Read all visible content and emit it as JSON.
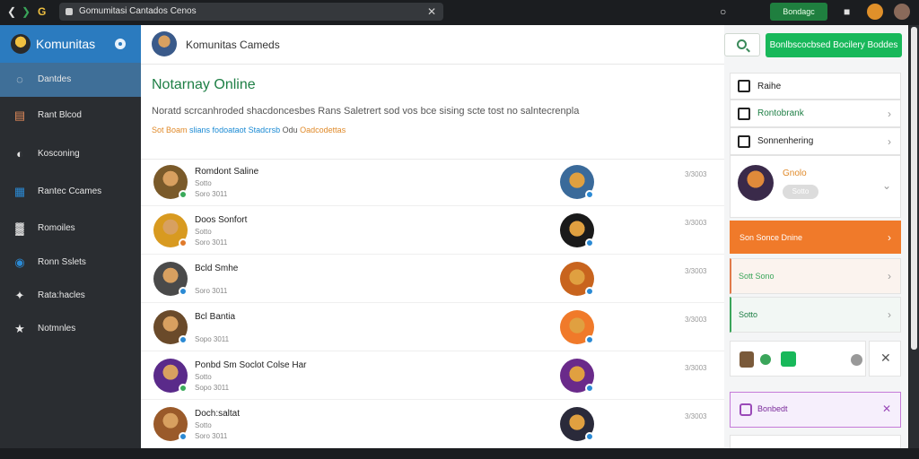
{
  "browser": {
    "tab_title": "Gomumitasi Cantados Cenos",
    "extension_label": "Bondagc"
  },
  "sidebar": {
    "title": "Komunitas",
    "items": [
      {
        "label": "Dantdes",
        "icon": "chat-icon"
      },
      {
        "label": "Rant Blcod",
        "icon": "card-icon"
      },
      {
        "label": "Kosconing",
        "icon": "gamepad-icon"
      },
      {
        "label": "Rantec Ccames",
        "icon": "grid-icon"
      },
      {
        "label": "Romoiles",
        "icon": "chart-icon"
      },
      {
        "label": "Ronn Sslets",
        "icon": "controller-icon"
      },
      {
        "label": "Rata:hacles",
        "icon": "puzzle-icon"
      },
      {
        "label": "Notmnles",
        "icon": "star-icon"
      }
    ]
  },
  "main": {
    "header_title": "Komunitas Cameds",
    "page_title": "Notarnay Online",
    "description": "Noratd scrcanhroded shacdoncesbes Rans Saletrert sod vos bce sising scte tost no salntecrenpla",
    "links": {
      "a": "Sot Boam",
      "b": "slians fodoataot Stadcrsb",
      "c": "Odu",
      "d": "Oadcodettas"
    },
    "rows": [
      {
        "name": "Romdont Saline",
        "sub1": "Sotto",
        "sub2": "Soro 3011",
        "time": "3/3003",
        "ava": "#7a5a2a",
        "badge": "#3aaa5a",
        "game": "#3a6a9a"
      },
      {
        "name": "Doos Sonfort",
        "sub1": "Sotto",
        "sub2": "Soro 3011",
        "time": "3/3003",
        "ava": "#d89a20",
        "badge": "#e07a2a",
        "game": "#1a1a1a"
      },
      {
        "name": "Bcld Smhe",
        "sub1": "",
        "sub2": "Soro 3011",
        "time": "3/3003",
        "ava": "#4a4a4a",
        "badge": "#2b8ad4",
        "game": "#c8641e"
      },
      {
        "name": "Bcl Bantia",
        "sub1": "",
        "sub2": "Sopo 3011",
        "time": "3/3003",
        "ava": "#6a4a2a",
        "badge": "#2b8ad4",
        "game": "#f07a2a"
      },
      {
        "name": "Ponbd Sm Soclot Colse Har",
        "sub1": "Sotto",
        "sub2": "Sopo 3011",
        "time": "3/3003",
        "ava": "#5a2a8a",
        "badge": "#3aaa5a",
        "game": "#6a2a8a"
      },
      {
        "name": "Doch:saltat",
        "sub1": "Sotto",
        "sub2": "Soro 3011",
        "time": "3/3003",
        "ava": "#9a5a2a",
        "badge": "#2b8ad4",
        "game": "#2a2a3a"
      }
    ]
  },
  "right": {
    "cta_label": "Bonlbscocbsed Bocilery Boddes",
    "cards": [
      {
        "label": "Raihe"
      },
      {
        "label": "Rontobrank"
      },
      {
        "label": "Sonnenhering"
      },
      {
        "label": "Gnolo",
        "pill": "Sotto"
      },
      {
        "label": "Son Sonce Dnine"
      },
      {
        "label": "Sott Sono"
      },
      {
        "label": "Sotto"
      },
      {
        "label": ""
      },
      {
        "label": "Bonbedt"
      }
    ]
  }
}
